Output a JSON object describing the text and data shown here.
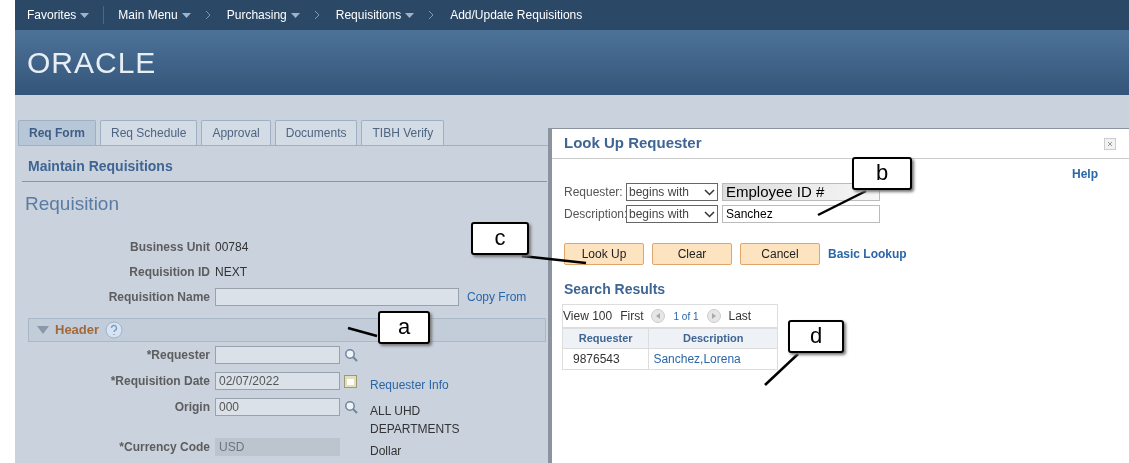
{
  "breadcrumb": [
    {
      "label": "Favorites",
      "kind": "menu"
    },
    {
      "label": "Main Menu",
      "kind": "menu"
    },
    {
      "label": "Purchasing",
      "kind": "menu"
    },
    {
      "label": "Requisitions",
      "kind": "menu"
    },
    {
      "label": "Add/Update Requisitions",
      "kind": "page"
    }
  ],
  "logo": "ORACLE",
  "tabs": [
    {
      "label": "Req Form",
      "selected": true
    },
    {
      "label": "Req Schedule",
      "selected": false
    },
    {
      "label": "Approval",
      "selected": false
    },
    {
      "label": "Documents",
      "selected": false
    },
    {
      "label": "TIBH Verify",
      "selected": false
    }
  ],
  "page_heading": "Maintain Requisitions",
  "page_title": "Requisition",
  "summary_fields": [
    {
      "label": "Business Unit",
      "kind": "text",
      "value": "00784"
    },
    {
      "label": "Requisition ID",
      "kind": "text",
      "value": "NEXT"
    },
    {
      "label": "Requisition Name",
      "kind": "input",
      "link": "Copy From"
    }
  ],
  "header_section": {
    "title": "Header",
    "expanded": true,
    "fields": [
      {
        "label": "*Requester",
        "kind": "lookup",
        "disabled": false
      },
      {
        "label": "*Requisition Date",
        "kind": "date",
        "value": "02/07/2022",
        "disabled": false,
        "side_link": "Requester Info"
      },
      {
        "label": "Origin",
        "kind": "lookup",
        "value": "000",
        "disabled": false,
        "side_text": "ALL UHD DEPARTMENTS"
      },
      {
        "label": "*Currency Code",
        "kind": "input",
        "value": "USD",
        "disabled": true,
        "side_text": "Dollar"
      }
    ]
  },
  "dialog": {
    "title": "Look Up Requester",
    "help": "Help",
    "criteria": [
      {
        "label": "Requester:",
        "operator": "begins with",
        "value": "Employee ID #"
      },
      {
        "label": "Description:",
        "operator": "begins with",
        "value": "Sanchez"
      }
    ],
    "buttons": [
      "Look Up",
      "Clear",
      "Cancel"
    ],
    "basic_lookup": "Basic Lookup",
    "results_heading": "Search Results",
    "pager": {
      "view": "View 100",
      "first": "First",
      "count": "1 of 1",
      "last": "Last"
    },
    "columns": [
      "Requester",
      "Description"
    ],
    "rows": [
      [
        "9876543",
        "Sanchez,Lorena"
      ]
    ]
  },
  "callouts": [
    "a",
    "b",
    "c",
    "d"
  ]
}
